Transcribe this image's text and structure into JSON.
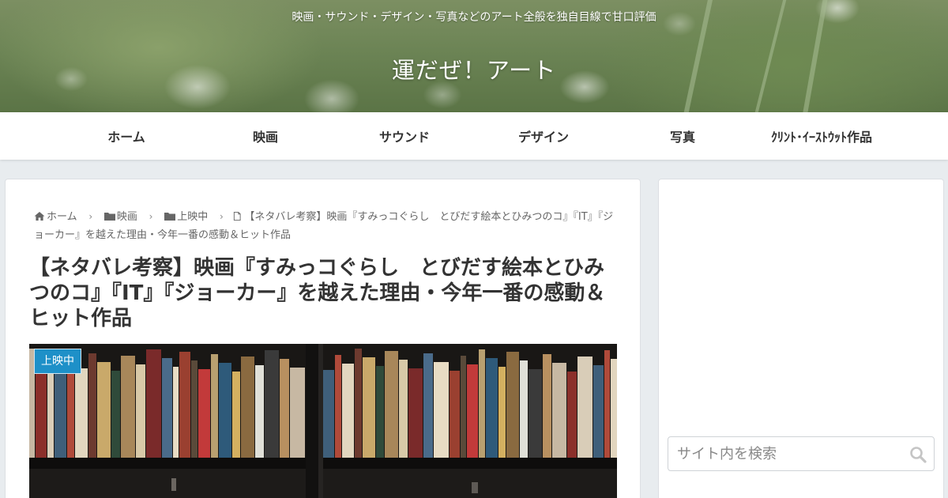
{
  "header": {
    "tagline": "映画・サウンド・デザイン・写真などのアート全般を独自目線で甘口評価",
    "site_title": "運だぜ！アート"
  },
  "nav": {
    "items": [
      {
        "label": "ホーム"
      },
      {
        "label": "映画"
      },
      {
        "label": "サウンド"
      },
      {
        "label": "デザイン"
      },
      {
        "label": "写真"
      },
      {
        "label": "ｸﾘﾝﾄ･ｲｰｽﾄｳｯﾄ作品"
      }
    ]
  },
  "breadcrumb": {
    "home": "ホーム",
    "category": "映画",
    "subcategory": "上映中",
    "current": "【ネタバレ考察】映画『すみっコぐらし　とびだす絵本とひみつのコ』『IT』『ジョーカー』を越えた理由・今年一番の感動＆ヒット作品"
  },
  "post": {
    "title": "【ネタバレ考察】映画『すみっコぐらし　とびだす絵本とひみつのコ』『IT』『ジョーカー』を越えた理由・今年一番の感動＆ヒット作品",
    "category_badge": "上映中"
  },
  "sidebar": {
    "search": {
      "placeholder": "サイト内を検索"
    }
  },
  "colors": {
    "accent": "#1e90c8",
    "background": "#e8ecef"
  }
}
